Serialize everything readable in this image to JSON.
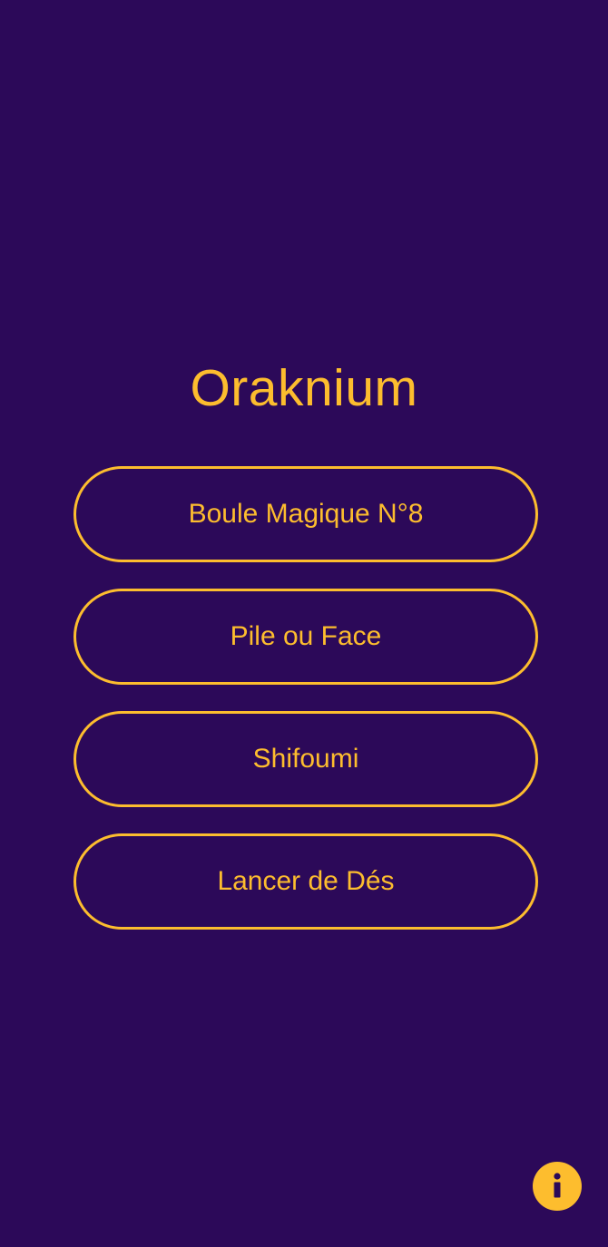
{
  "app": {
    "title": "Oraknium"
  },
  "menu": {
    "items": [
      {
        "label": "Boule Magique N°8"
      },
      {
        "label": "Pile ou Face"
      },
      {
        "label": "Shifoumi"
      },
      {
        "label": "Lancer de Dés"
      }
    ]
  },
  "info_button": {
    "icon": "info-icon"
  },
  "colors": {
    "background": "#2c0959",
    "accent": "#fdbd2e"
  }
}
